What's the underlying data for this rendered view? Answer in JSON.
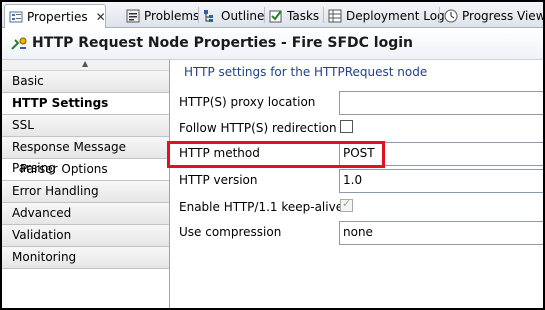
{
  "tabs": [
    {
      "label": "Properties",
      "icon": "properties-icon",
      "active": true
    },
    {
      "label": "Problems",
      "icon": "problems-icon"
    },
    {
      "label": "Outline",
      "icon": "outline-icon"
    },
    {
      "label": "Tasks",
      "icon": "tasks-icon"
    },
    {
      "label": "Deployment Log",
      "icon": "deployment-log-icon"
    },
    {
      "label": "Progress View",
      "icon": "progress-view-icon"
    }
  ],
  "title": "HTTP Request Node Properties - Fire SFDC login",
  "nav": [
    {
      "label": "Basic"
    },
    {
      "label": "HTTP Settings",
      "selected": true
    },
    {
      "label": "SSL"
    },
    {
      "label": "Response Message Parsing"
    },
    {
      "label": "Parser Options",
      "sub": true
    },
    {
      "label": "Error Handling"
    },
    {
      "label": "Advanced"
    },
    {
      "label": "Validation"
    },
    {
      "label": "Monitoring"
    }
  ],
  "panel": {
    "hint": "HTTP settings for the HTTPRequest node",
    "fields": [
      {
        "label": "HTTP(S) proxy location",
        "value": ""
      },
      {
        "label": "Follow HTTP(S) redirection",
        "checked": false
      },
      {
        "label": "HTTP method",
        "value": "POST"
      },
      {
        "label": "HTTP version",
        "value": "1.0"
      },
      {
        "label": "Enable HTTP/1.1 keep-alive",
        "checked": true,
        "disabled": true
      },
      {
        "label": "Use compression",
        "value": "none"
      }
    ]
  },
  "colors": {
    "highlight": "#e4101b",
    "hint": "#1f3f8f"
  }
}
